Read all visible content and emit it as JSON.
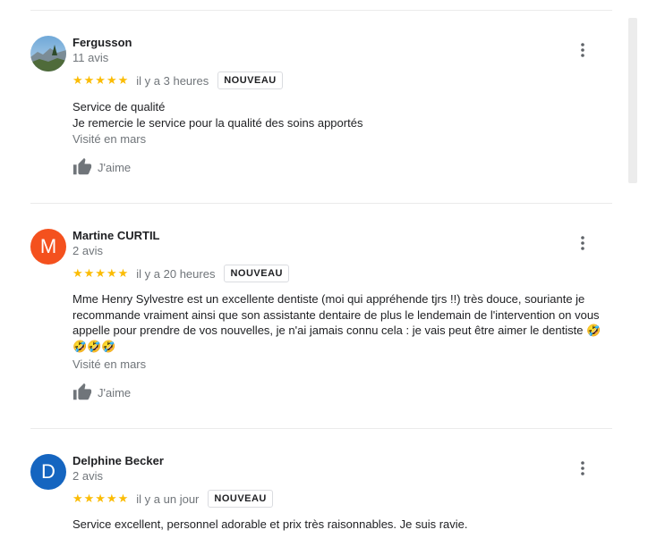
{
  "reviews": [
    {
      "name": "Fergusson",
      "count": "11 avis",
      "stars": "★★★★★",
      "time": "il y a 3 heures",
      "badge": "NOUVEAU",
      "text": "Service de qualité\nJe remercie le service pour la qualité des soins apportés",
      "visited": "Visité en mars",
      "like": "J'aime",
      "avatar_type": "photo"
    },
    {
      "name": "Martine CURTIL",
      "count": "2 avis",
      "stars": "★★★★★",
      "time": "il y a 20 heures",
      "badge": "NOUVEAU",
      "text": "Mme Henry Sylvestre est un excellente dentiste (moi qui appréhende tjrs !!) très douce, souriante je recommande vraiment ainsi que son assistante dentaire de plus le lendemain de l'intervention on vous appelle pour prendre de vos nouvelles, je n'ai jamais connu cela : je vais peut être aimer le dentiste 🤣\n🤣🤣🤣",
      "visited": "Visité en mars",
      "like": "J'aime",
      "avatar_letter": "M",
      "avatar_color": "#f4511e"
    },
    {
      "name": "Delphine Becker",
      "count": "2 avis",
      "stars": "★★★★★",
      "time": "il y a un jour",
      "badge": "NOUVEAU",
      "text": "Service excellent, personnel adorable et prix très raisonnables. Je suis ravie.",
      "avatar_letter": "D",
      "avatar_color": "#1565c0"
    }
  ],
  "icons": {
    "like": "thumb-up-icon",
    "menu": "more-vertical-icon"
  }
}
